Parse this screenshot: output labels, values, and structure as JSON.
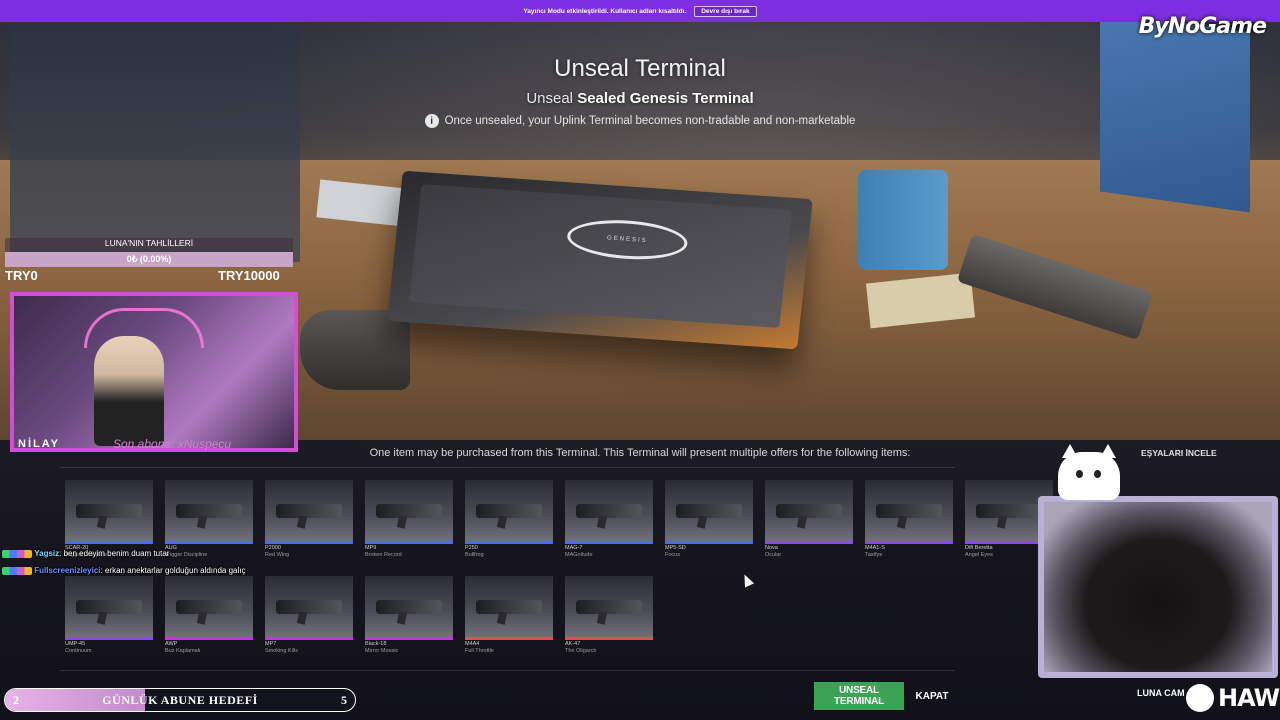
{
  "banner": {
    "message": "Yayıncı Modu etkinleştirildi. Kullanıcı adları kısaltıldı.",
    "button": "Devre dışı bırak"
  },
  "brand_logo": "ByNoGame",
  "header": {
    "title": "Unseal Terminal",
    "subtitle_prefix": "Unseal",
    "subtitle_item": "Sealed Genesis Terminal",
    "notice": "Once unsealed, your Uplink Terminal becomes non-tradable and non-marketable",
    "notice_icon": "info-icon"
  },
  "terminal_emblem": "GENESIS",
  "offer_text": "One item may be purchased from this Terminal. This Terminal will present multiple offers for the following items:",
  "inspect_label": "EŞYALARI İNCELE",
  "items": [
    {
      "weapon": "SCAR-20",
      "skin": "Trigger Discipline",
      "rarity": "blue"
    },
    {
      "weapon": "AUG",
      "skin": "Trigger Discipline",
      "rarity": "blue"
    },
    {
      "weapon": "P2000",
      "skin": "Red Wing",
      "rarity": "blue"
    },
    {
      "weapon": "MP9",
      "skin": "Broken Record",
      "rarity": "blue"
    },
    {
      "weapon": "P250",
      "skin": "Bullfrog",
      "rarity": "blue"
    },
    {
      "weapon": "MAG-7",
      "skin": "MAGnitude",
      "rarity": "blue"
    },
    {
      "weapon": "MP5-SD",
      "skin": "Focus",
      "rarity": "blue"
    },
    {
      "weapon": "Nova",
      "skin": "Ocular",
      "rarity": "purple"
    },
    {
      "weapon": "M4A1-S",
      "skin": "Tastfye",
      "rarity": "purple"
    },
    {
      "weapon": "Dift Beretta",
      "skin": "Angel Eyes",
      "rarity": "purple"
    },
    {
      "weapon": "UMP-45",
      "skin": "Continuum",
      "rarity": "purple"
    },
    {
      "weapon": "AWP",
      "skin": "Buz Kaplamalı",
      "rarity": "pink"
    },
    {
      "weapon": "MP7",
      "skin": "Smoking Kills",
      "rarity": "pink"
    },
    {
      "weapon": "Black-18",
      "skin": "Mirror Mosaic",
      "rarity": "pink"
    },
    {
      "weapon": "M4A4",
      "skin": "Full Throttle",
      "rarity": "red"
    },
    {
      "weapon": "AK-47",
      "skin": "The Oligarch",
      "rarity": "red"
    }
  ],
  "buttons": {
    "unseal": "UNSEAL TERMINAL",
    "close": "KAPAT"
  },
  "donation_goal": {
    "title": "LUNA'NIN TAHLİLLERİ",
    "progress_text": "0₺ (0.00%)",
    "progress": 0.0,
    "min_label": "TRY0",
    "max_label": "TRY10000"
  },
  "streamer": {
    "name": "NİLAY",
    "latest_sub": "Son abone: xNuspecu"
  },
  "chat": [
    {
      "user": "Yagsiz",
      "message": "ben edeyim benim duam tutar"
    },
    {
      "user": "Fullscreenizleyici",
      "message": "erkan anektarlar golduğun aldında galıç"
    }
  ],
  "sub_goal": {
    "label": "GÜNLÜK ABUNE HEDEFİ",
    "current": "2",
    "target": "5",
    "progress": 0.4
  },
  "pet_cam_label": "LUNA CAM",
  "sponsor": "HAWK",
  "colors": {
    "banner": "#7b2fe0",
    "unseal_button": "#3aa354",
    "rarity_blue": "#4b69ff",
    "rarity_purple": "#8847ff",
    "rarity_pink": "#d32ee6",
    "rarity_red": "#eb4b4b",
    "cam_border": "#d64cd6"
  }
}
